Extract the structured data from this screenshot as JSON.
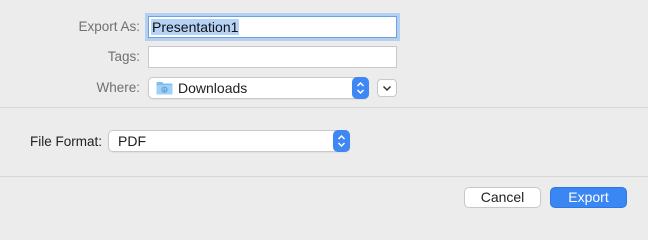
{
  "export_as": {
    "label": "Export As:",
    "value": "Presentation1"
  },
  "tags": {
    "label": "Tags:",
    "value": ""
  },
  "where": {
    "label": "Where:",
    "value": "Downloads",
    "icon": "folder-downloads-icon"
  },
  "file_format": {
    "label": "File Format:",
    "value": "PDF"
  },
  "buttons": {
    "cancel": "Cancel",
    "export": "Export"
  },
  "colors": {
    "accent": "#3a86f3",
    "background": "#ececec",
    "selection": "#b5d2f7"
  }
}
